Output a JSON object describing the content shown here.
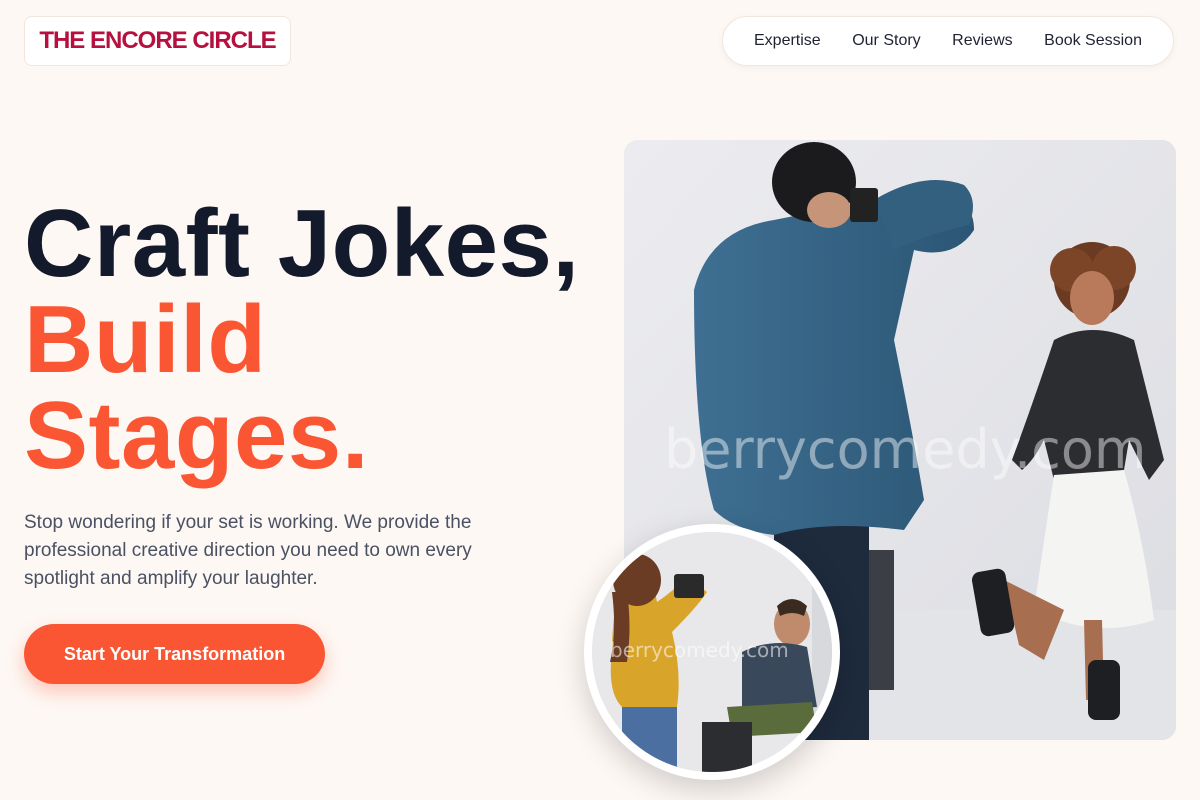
{
  "header": {
    "logo_text": "THE ENCORE CIRCLE",
    "nav": [
      {
        "label": "Expertise"
      },
      {
        "label": "Our Story"
      },
      {
        "label": "Reviews"
      },
      {
        "label": "Book Session"
      }
    ]
  },
  "hero": {
    "title_line1": "Craft Jokes,",
    "title_line2": "Build",
    "title_line3": "Stages.",
    "description": "Stop wondering if your set is working. We provide the professional creative direction you need to own every spotlight and amplify your laughter.",
    "cta_label": "Start Your Transformation"
  },
  "photos": {
    "main_watermark": "berrycomedy.com",
    "inset_watermark": "berrycomedy.com"
  },
  "colors": {
    "accent": "#fb5633",
    "brand": "#b5103f",
    "heading": "#131a2c",
    "background": "#fdf8f4"
  }
}
